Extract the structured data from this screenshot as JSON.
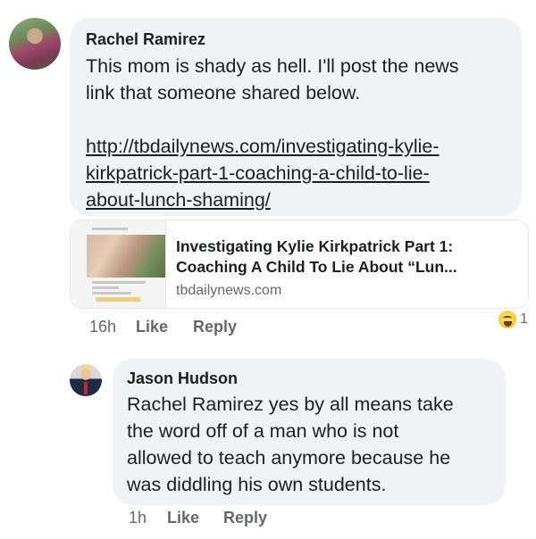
{
  "comment_1": {
    "author": "Rachel Ramirez",
    "text_lines": [
      "This mom is shady as hell. I'll post the news",
      "link that someone shared below."
    ],
    "link_lines": [
      "http://tbdailynews.com/investigating-kylie-",
      "kirkpatrick-part-1-coaching-a-child-to-lie-",
      "about-lunch-shaming/"
    ],
    "preview": {
      "title_line_1": "Investigating Kylie Kirkpatrick Part 1:",
      "title_line_2": "Coaching A Child To Lie About “Lun...",
      "domain": "tbdailynews.com"
    },
    "time": "16h",
    "like_label": "Like",
    "reply_label": "Reply",
    "reaction": {
      "icon": "haha-emoji-icon",
      "count": "1"
    }
  },
  "comment_2": {
    "author": "Jason Hudson",
    "text_lines": [
      "Rachel Ramirez yes by all means take",
      "the word off of a man who is not",
      "allowed to teach anymore because he",
      "was diddling his own students."
    ],
    "time": "1h",
    "like_label": "Like",
    "reply_label": "Reply"
  }
}
